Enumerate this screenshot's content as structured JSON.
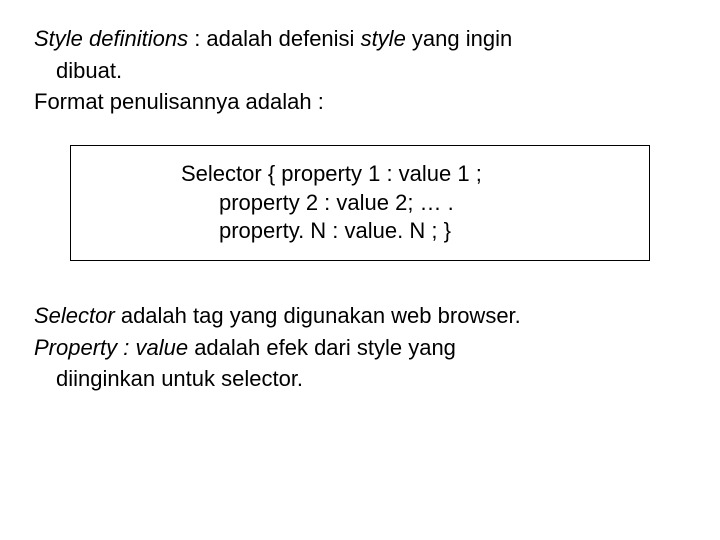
{
  "p1": {
    "t1_italic": "Style definitions",
    "t1_rest": " : adalah defenisi ",
    "t1_italic2": "style",
    "t1_rest2": " yang ingin",
    "t2": "dibuat.",
    "t3": "Format penulisannya adalah :"
  },
  "code": {
    "l1": "Selector { property 1 : value 1 ;",
    "l2": "property 2 : value 2; … .",
    "l3": "property. N : value. N ; }"
  },
  "p2": {
    "t1_italic": "Selector",
    "t1_rest": "  adalah tag yang digunakan web browser.",
    "t2_italic": "Property : value",
    "t2_rest": " adalah efek dari style yang",
    "t3": "diinginkan untuk selector."
  }
}
